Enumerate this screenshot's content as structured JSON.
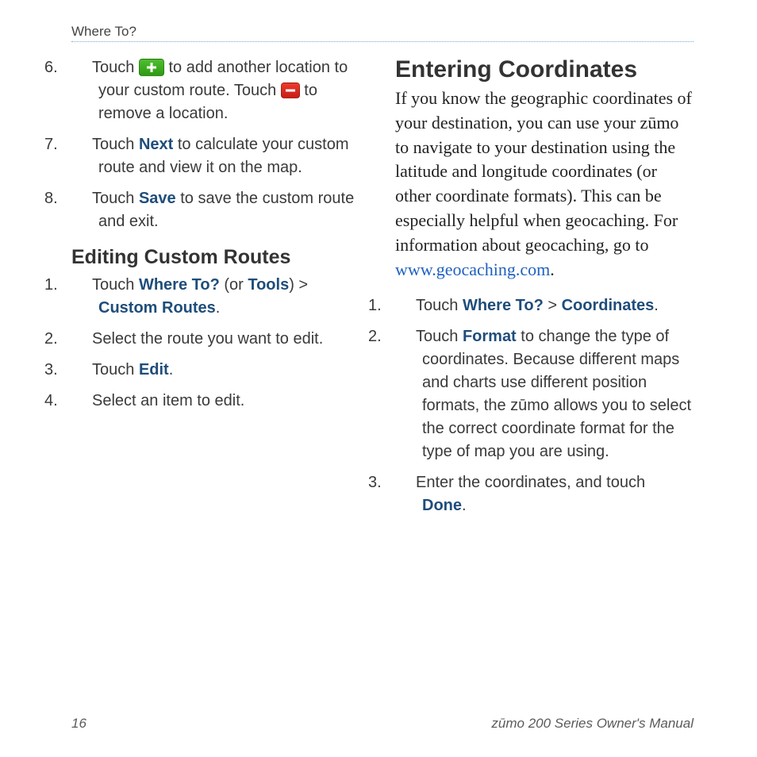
{
  "header": {
    "section_label": "Where To?"
  },
  "left": {
    "step6": {
      "num": "6.",
      "t1": "Touch ",
      "t2": " to add another location to your custom route. Touch ",
      "t3": " to remove a location."
    },
    "step7": {
      "num": "7.",
      "t1": "Touch ",
      "kw": "Next",
      "t2": " to calculate your custom route and view it on the map."
    },
    "step8": {
      "num": "8.",
      "t1": "Touch ",
      "kw": "Save",
      "t2": " to save the custom route and exit."
    },
    "editing_heading": "Editing Custom Routes",
    "e1": {
      "num": "1.",
      "t1": "Touch ",
      "kw1": "Where To?",
      "t2": " (or ",
      "kw2": "Tools",
      "t3": ") > ",
      "kw3": "Custom Routes",
      "t4": "."
    },
    "e2": {
      "num": "2.",
      "text": "Select the route you want to edit."
    },
    "e3": {
      "num": "3.",
      "t1": "Touch ",
      "kw": "Edit",
      "t2": "."
    },
    "e4": {
      "num": "4.",
      "text": "Select an item to edit."
    }
  },
  "right": {
    "heading": "Entering Coordinates",
    "para_a": "If you know the geographic coordinates of your destination, you can use your zūmo to navigate to your destination using the latitude and longitude coordinates (or other coordinate formats). This can be especially helpful when geocaching. For information about geocaching, go to ",
    "para_link": "www.geocaching.com",
    "para_b": ".",
    "s1": {
      "num": "1.",
      "t1": "Touch ",
      "kw1": "Where To?",
      "t2": " > ",
      "kw2": "Coordinates",
      "t3": "."
    },
    "s2": {
      "num": "2.",
      "t1": "Touch ",
      "kw": "Format",
      "t2": " to change the type of coordinates. Because different maps and charts use different position formats, the zūmo allows you to select the correct coordinate format for the type of map you are using."
    },
    "s3": {
      "num": "3.",
      "t1": "Enter the coordinates, and touch ",
      "kw": "Done",
      "t2": "."
    }
  },
  "footer": {
    "page": "16",
    "title": "zūmo 200 Series Owner's Manual"
  }
}
